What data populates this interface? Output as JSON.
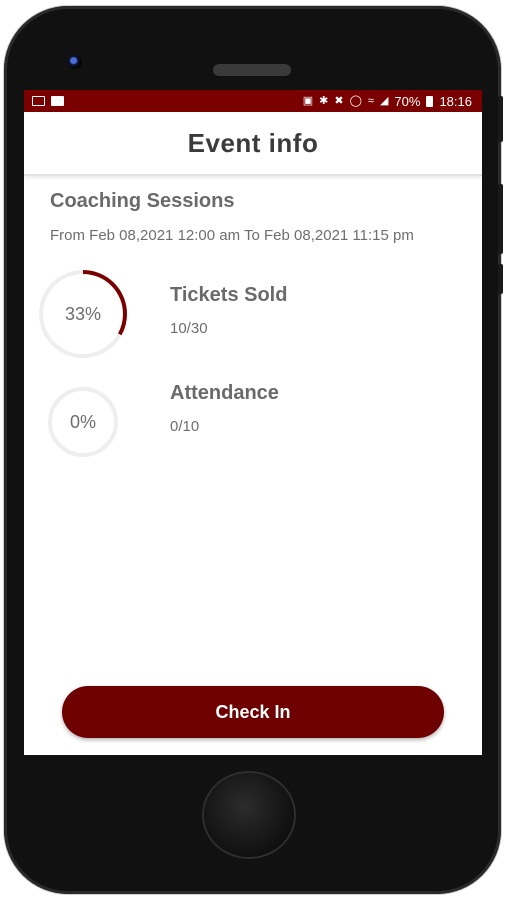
{
  "status_bar": {
    "battery_percent": "70%",
    "time": "18:16",
    "color": "#7a0000"
  },
  "header": {
    "title": "Event info"
  },
  "event": {
    "name": "Coaching Sessions",
    "dates": "From Feb 08,2021 12:00 am To Feb 08,2021 11:15 pm"
  },
  "stats": {
    "tickets": {
      "percent_label": "33%",
      "progress": 0.33,
      "title": "Tickets Sold",
      "value": "10/30"
    },
    "attendance": {
      "percent_label": "0%",
      "progress": 0,
      "title": "Attendance",
      "value": "0/10"
    }
  },
  "actions": {
    "check_in_label": "Check In"
  },
  "colors": {
    "accent": "#7a0000",
    "button": "#6e0000",
    "ring_track": "#eeeeee"
  }
}
